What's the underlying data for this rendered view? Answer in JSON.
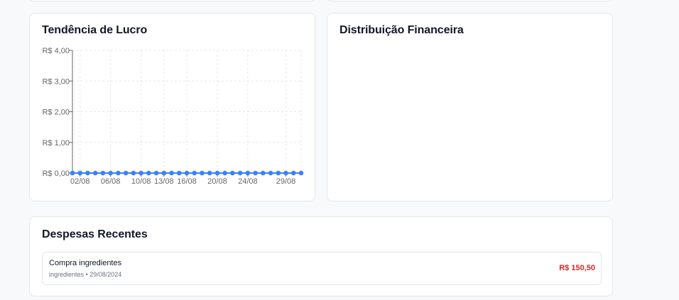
{
  "trend": {
    "title": "Tendência de Lucro"
  },
  "distribution": {
    "title": "Distribuição Financeira"
  },
  "expenses": {
    "title": "Despesas Recentes",
    "items": [
      {
        "name": "Compra ingredientes",
        "category": "ingredientes",
        "separator": "•",
        "date": "29/08/2024",
        "amount": "R$ 150,50"
      }
    ]
  },
  "colors": {
    "line": "#3b82f6",
    "expense_amount": "#dc2626",
    "grid": "#e5e7eb"
  },
  "chart_data": {
    "type": "line",
    "title": "Tendência de Lucro",
    "xlabel": "",
    "ylabel": "",
    "x": [
      "01/08",
      "02/08",
      "03/08",
      "04/08",
      "05/08",
      "06/08",
      "07/08",
      "08/08",
      "09/08",
      "10/08",
      "11/08",
      "12/08",
      "13/08",
      "14/08",
      "15/08",
      "16/08",
      "17/08",
      "18/08",
      "19/08",
      "20/08",
      "21/08",
      "22/08",
      "23/08",
      "24/08",
      "25/08",
      "26/08",
      "27/08",
      "28/08",
      "29/08",
      "30/08",
      "31/08"
    ],
    "x_tick_labels": [
      "02/08",
      "06/08",
      "10/08",
      "13/08",
      "16/08",
      "20/08",
      "24/08",
      "29/08"
    ],
    "series": [
      {
        "values": [
          0,
          0,
          0,
          0,
          0,
          0,
          0,
          0,
          0,
          0,
          0,
          0,
          0,
          0,
          0,
          0,
          0,
          0,
          0,
          0,
          0,
          0,
          0,
          0,
          0,
          0,
          0,
          0,
          0,
          0,
          0
        ]
      }
    ],
    "y_ticks": [
      0,
      1,
      2,
      3,
      4
    ],
    "y_tick_labels": [
      "R$ 0,00",
      "R$ 1,00",
      "R$ 2,00",
      "R$ 3,00",
      "R$ 4,00"
    ],
    "ylim": [
      0,
      4
    ],
    "grid": true,
    "legend": "none"
  }
}
